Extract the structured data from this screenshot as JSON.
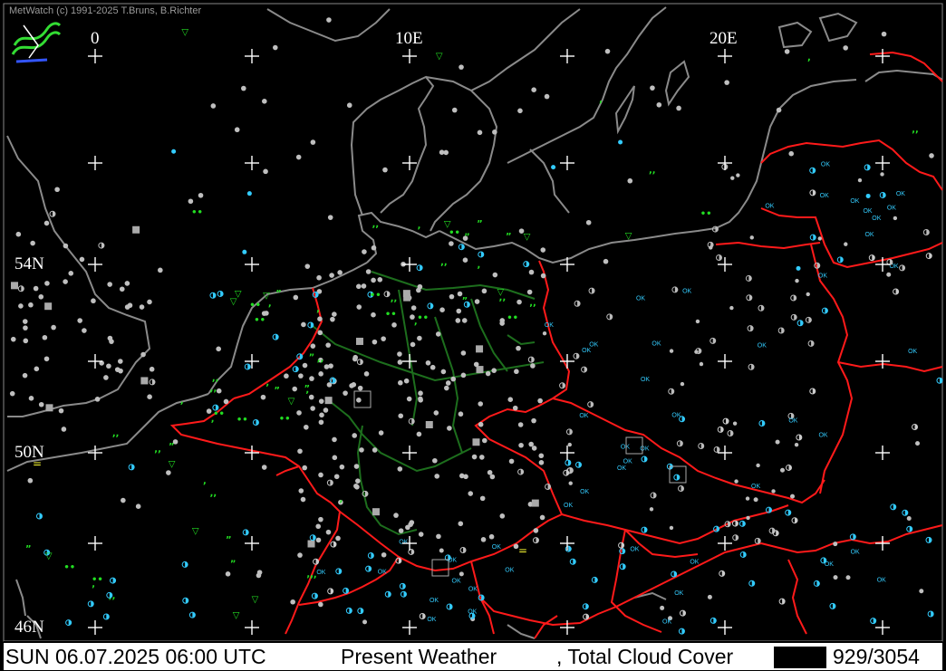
{
  "copyright": "MetWatch  (c) 1991-2025 T.Bruns, B.Richter",
  "lon_labels": [
    "0",
    "10E",
    "20E"
  ],
  "lat_labels": [
    "54N",
    "50N",
    "46N"
  ],
  "status": {
    "datetime": "SUN 06.07.2025 06:00 UTC",
    "product": "Present Weather",
    "product2": ", Total Cloud Cover",
    "count": "929/3054"
  },
  "colors": {
    "background": "#000000",
    "coastline": "#808080",
    "border": "#ff0000",
    "state_border": "#1a6e1a",
    "grid": "#ffffff",
    "station_gray": "#bfbfbf",
    "station_cyan": "#33ccff",
    "weather_green": "#22dd22",
    "weather_yellow": "#ffff33"
  },
  "station_text": "OK",
  "icons": [
    "metwatch-logo-icon",
    "grid-cross-icon",
    "station-dot-icon",
    "cloud-half-icon",
    "drizzle-icon",
    "rain-icon",
    "fog-icon",
    "thunderstorm-icon"
  ]
}
